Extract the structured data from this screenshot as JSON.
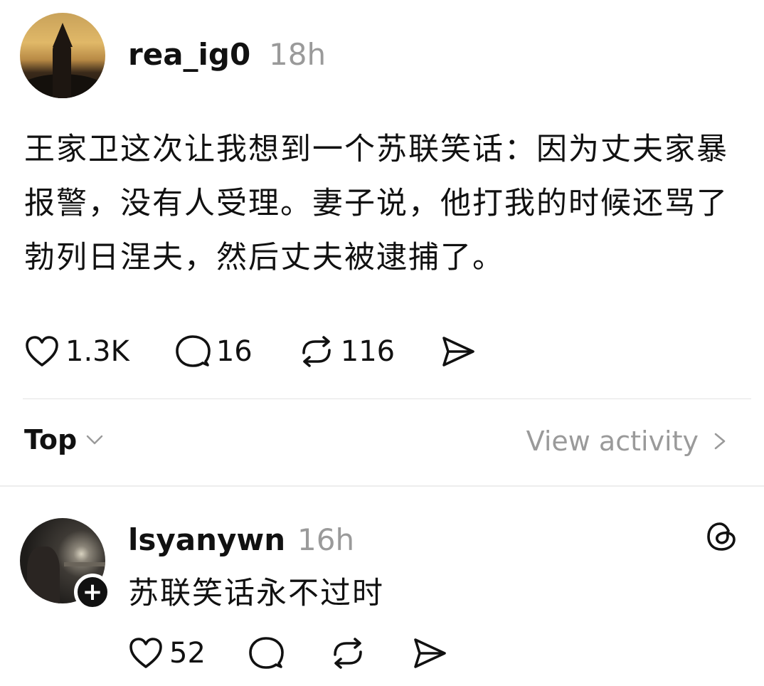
{
  "post": {
    "username": "rea_ig0",
    "timestamp": "18h",
    "text": "王家卫这次让我想到一个苏联笑话：因为丈夫家暴报警，没有人受理。妻子说，他打我的时候还骂了勃列日涅夫，然后丈夫被逮捕了。",
    "likes": "1.3K",
    "replies": "16",
    "reposts": "116"
  },
  "sort": {
    "label": "Top",
    "view_activity": "View activity"
  },
  "reply": {
    "username": "lsyanywn",
    "timestamp": "16h",
    "text": "苏联笑话永不过时",
    "likes": "52"
  },
  "icons": {
    "like": "heart-icon",
    "comment": "comment-bubble-icon",
    "repost": "repost-icon",
    "share": "share-send-icon",
    "threads": "threads-logo-icon",
    "follow": "plus-icon"
  }
}
